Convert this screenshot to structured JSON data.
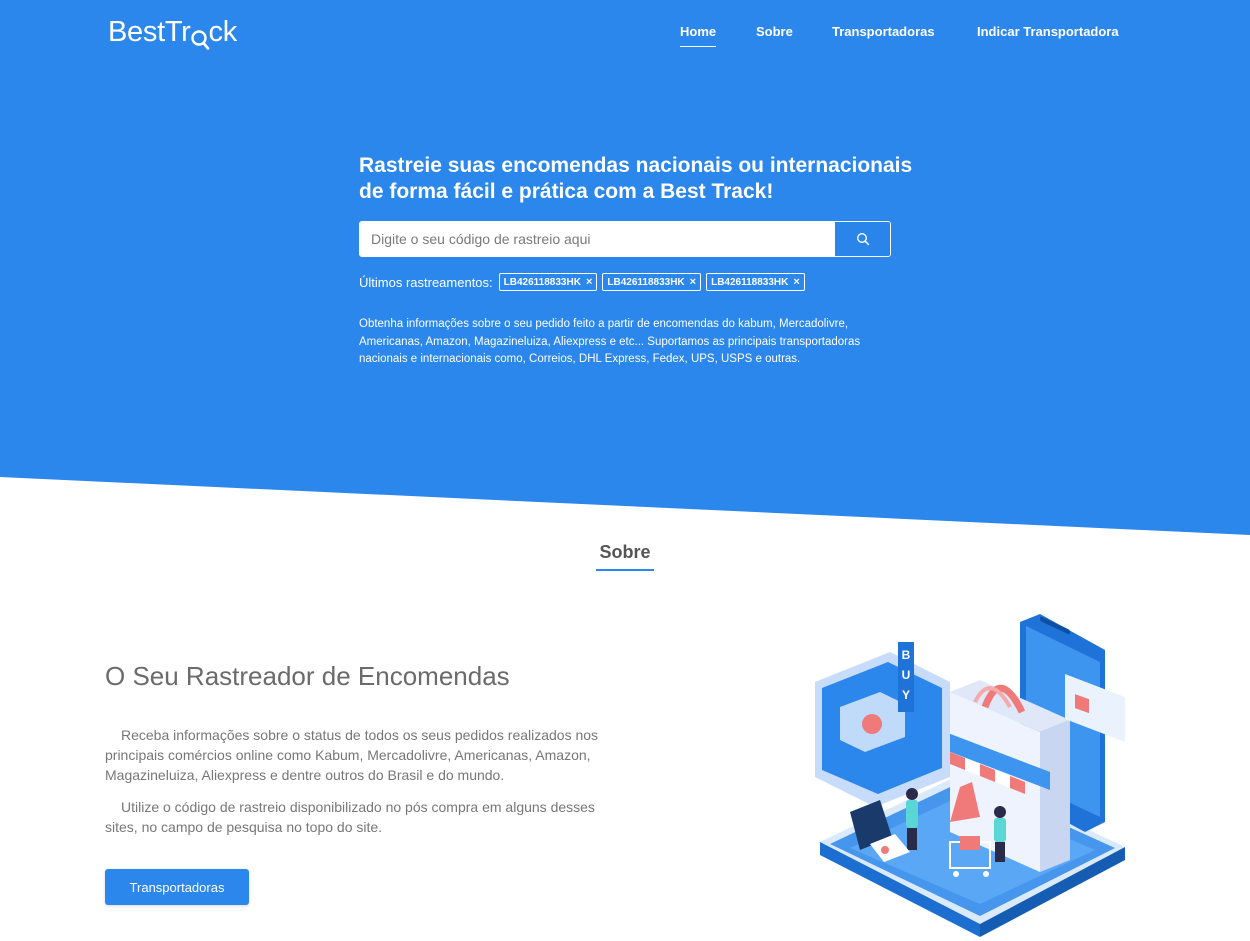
{
  "brand": {
    "logo_text_1": "BestTr",
    "logo_text_2": "ck"
  },
  "nav": [
    {
      "label": "Home",
      "active": true
    },
    {
      "label": "Sobre",
      "active": false
    },
    {
      "label": "Transportadoras",
      "active": false
    },
    {
      "label": "Indicar Transportadora",
      "active": false
    }
  ],
  "hero": {
    "headline": "Rastreie suas encomendas nacionais ou internacionais de forma fácil e prática com a Best Track!",
    "search_placeholder": "Digite o seu código de rastreio aqui",
    "recent_label": "Últimos rastreamentos:",
    "recent": [
      "LB426118833HK",
      "LB426118833HK",
      "LB426118833HK"
    ],
    "remove_glyph": "×",
    "description": "Obtenha informações sobre o seu pedido feito a partir de encomendas do kabum, Mercadolivre, Americanas, Amazon, Magazineluiza, Aliexpress e etc... Suportamos as principais transportadoras nacionais e internacionais como, Correios, DHL Express, Fedex, UPS, USPS e outras."
  },
  "about": {
    "section_title": "Sobre",
    "heading": "O Seu Rastreador de Encomendas",
    "paragraph_1": "Receba informações sobre o status de todos os seus pedidos realizados nos principais comércios online como Kabum, Mercadolivre, Americanas, Amazon, Magazineluiza, Aliexpress e dentre outros do Brasil e do mundo.",
    "paragraph_2": "Utilize o código de rastreio disponibilizado no pós compra em alguns desses sites, no campo de pesquisa no topo do site.",
    "button_label": "Transportadoras",
    "illustration_text": "BUY"
  },
  "colors": {
    "primary": "#2b87eb",
    "text_gray": "#777777",
    "heading_gray": "#6b6b6b"
  }
}
